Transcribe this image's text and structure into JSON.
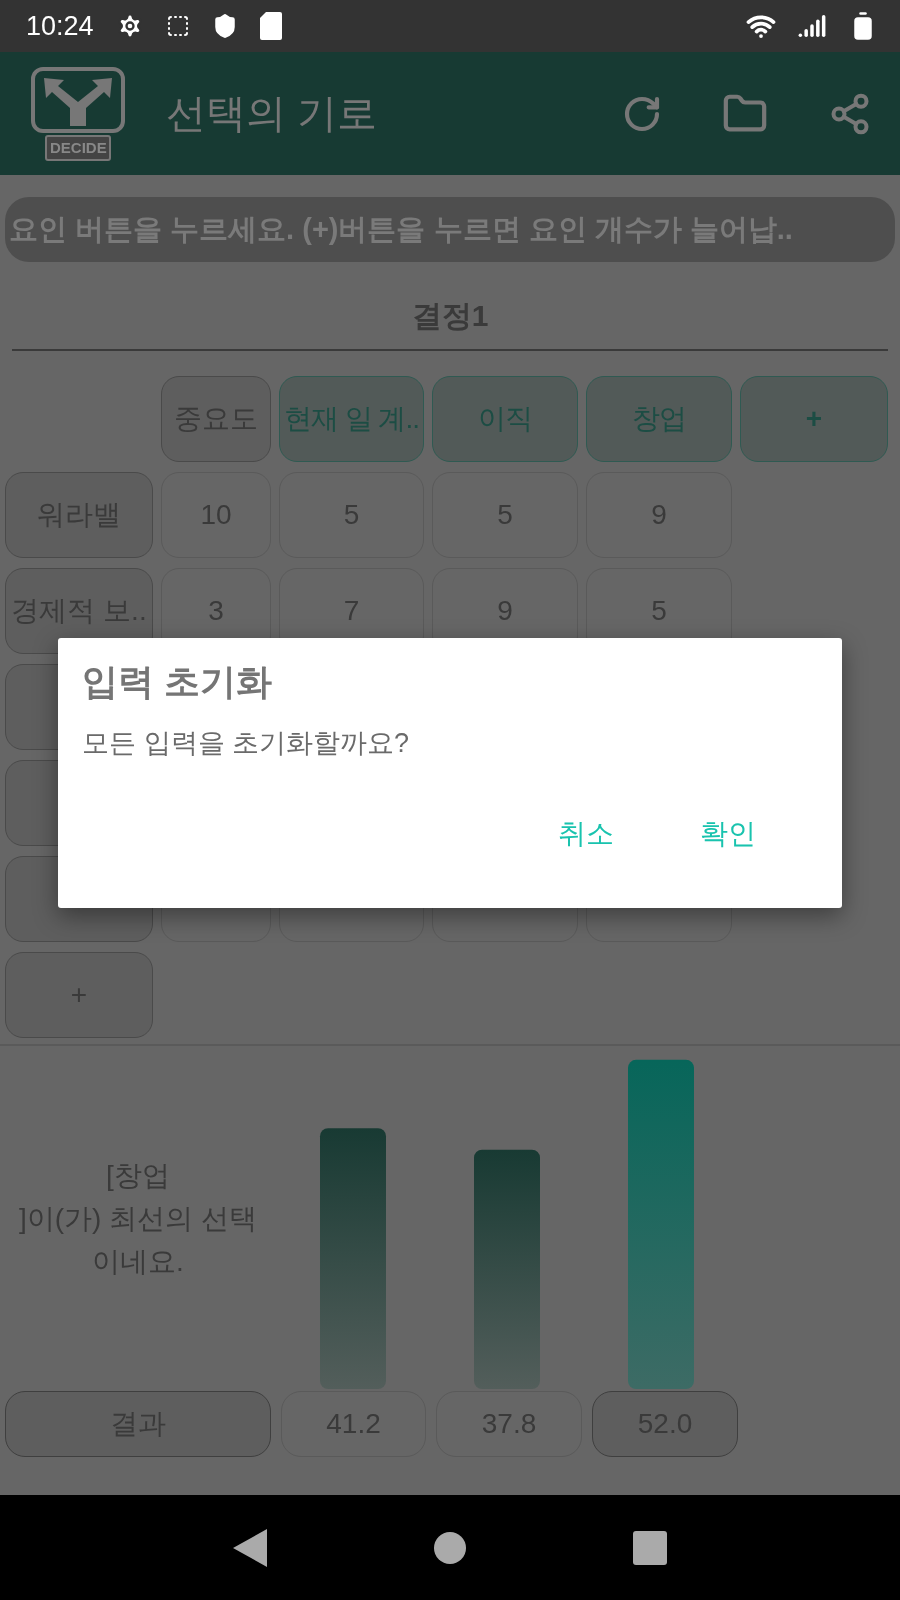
{
  "status_bar": {
    "time": "10:24"
  },
  "app_bar": {
    "logo_text": "DECIDE",
    "title": "선택의 기로"
  },
  "hint": "요인 버튼을 누르세요. (+)버튼을 누르면 요인 개수가 늘어납..",
  "decision_title": "결정1",
  "header": [
    {
      "label": "중요도",
      "kind": "weight"
    },
    {
      "label": "현재 일 계..",
      "kind": "option"
    },
    {
      "label": "이직",
      "kind": "option"
    },
    {
      "label": "창업",
      "kind": "option"
    },
    {
      "label": "+",
      "kind": "add"
    }
  ],
  "rows": [
    {
      "label": "워라밸",
      "values": [
        "10",
        "5",
        "5",
        "9"
      ]
    },
    {
      "label": "경제적 보..",
      "values": [
        "3",
        "7",
        "9",
        "5"
      ]
    },
    {
      "values": []
    },
    {
      "values": []
    },
    {
      "values": []
    }
  ],
  "add_row": "+",
  "verdict": "[창업\n]이(가) 최선의 선택\n이네요.",
  "results": {
    "label": "결과",
    "values": [
      {
        "value": "41.2",
        "selected": false
      },
      {
        "value": "37.8",
        "selected": false
      },
      {
        "value": "52.0",
        "selected": true
      }
    ]
  },
  "dialog": {
    "title": "입력 초기화",
    "message": "모든 입력을 초기화할까요?",
    "buttons": [
      "취소",
      "확인"
    ]
  }
}
